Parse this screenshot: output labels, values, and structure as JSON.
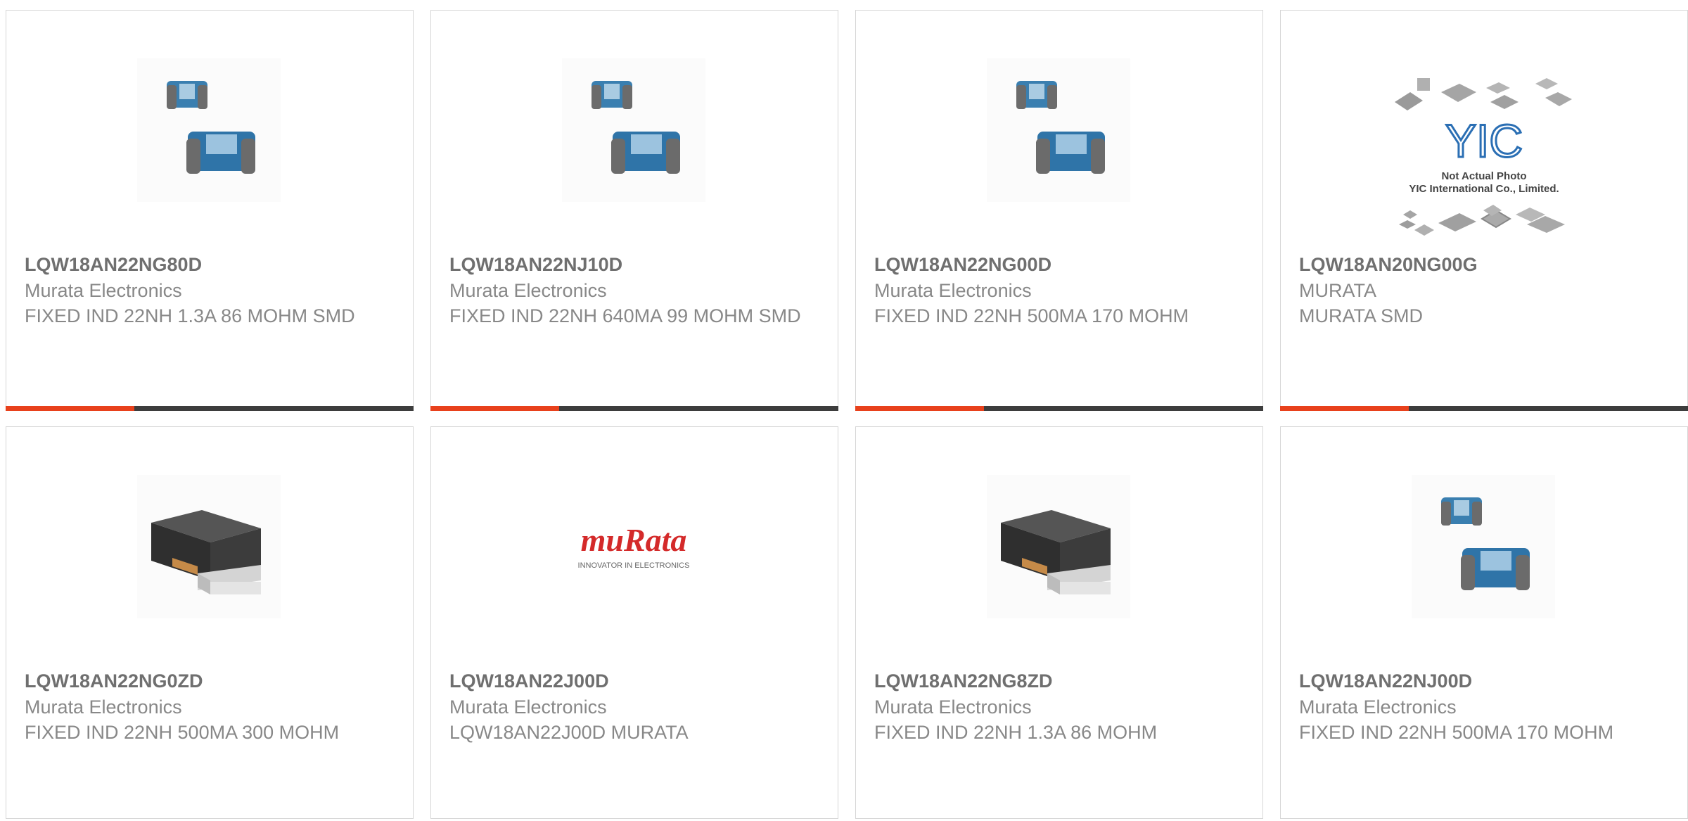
{
  "colors": {
    "accent_orange": "#e8411c",
    "accent_dark": "#3d3d3d",
    "text_bold": "#6f6f6f",
    "text": "#888888",
    "border": "#d6d6d6"
  },
  "products": [
    {
      "part_number": "LQW18AN22NG80D",
      "manufacturer": "Murata Electronics",
      "description": "FIXED IND 22NH 1.3A 86 MOHM SMD",
      "image": "blue-inductor-pair"
    },
    {
      "part_number": "LQW18AN22NJ10D",
      "manufacturer": "Murata Electronics",
      "description": "FIXED IND 22NH 640MA 99 MOHM SMD",
      "image": "blue-inductor-pair"
    },
    {
      "part_number": "LQW18AN22NG00D",
      "manufacturer": "Murata Electronics",
      "description": "FIXED IND 22NH 500MA 170 MOHM",
      "image": "blue-inductor-pair"
    },
    {
      "part_number": "LQW18AN20NG00G",
      "manufacturer": "MURATA",
      "description": "MURATA SMD",
      "image": "yic-placeholder",
      "image_text": {
        "logo": "YIC",
        "line1": "Not Actual Photo",
        "line2": "YIC International Co., Limited."
      }
    },
    {
      "part_number": "LQW18AN22NG0ZD",
      "manufacturer": "Murata Electronics",
      "description": "FIXED IND 22NH 500MA 300 MOHM",
      "image": "black-inductor"
    },
    {
      "part_number": "LQW18AN22J00D",
      "manufacturer": "Murata Electronics",
      "description": "LQW18AN22J00D MURATA",
      "image": "murata-logo",
      "image_text": {
        "logo": "muRata",
        "tagline": "INNOVATOR IN ELECTRONICS"
      }
    },
    {
      "part_number": "LQW18AN22NG8ZD",
      "manufacturer": "Murata Electronics",
      "description": "FIXED IND 22NH 1.3A 86 MOHM",
      "image": "black-inductor"
    },
    {
      "part_number": "LQW18AN22NJ00D",
      "manufacturer": "Murata Electronics",
      "description": "FIXED IND 22NH 500MA 170 MOHM",
      "image": "blue-inductor-pair"
    }
  ]
}
